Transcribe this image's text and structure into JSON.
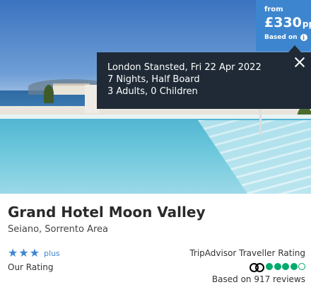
{
  "price": {
    "from_label": "from",
    "amount": "£330",
    "per_person": "pp",
    "based_on_label": "Based on",
    "info_icon": "info-icon"
  },
  "tooltip": {
    "lines": [
      "London Stansted, Fri 22 Apr 2022",
      "7 Nights, Half Board",
      "3 Adults, 0 Children"
    ],
    "close_icon": "close-icon"
  },
  "hotel": {
    "name": "Grand Hotel Moon Valley",
    "location": "Seiano, Sorrento Area"
  },
  "our_rating": {
    "stars": 3,
    "plus_label": "plus",
    "label": "Our Rating"
  },
  "tripadvisor": {
    "label": "TripAdvisor Traveller Rating",
    "rating": 4,
    "max_rating": 5,
    "reviews": "Based on 917 reviews"
  },
  "colors": {
    "accent_blue": "#3d86cf",
    "tooltip_bg": "#1f2a36",
    "tripadvisor_green": "#00aa6c"
  }
}
